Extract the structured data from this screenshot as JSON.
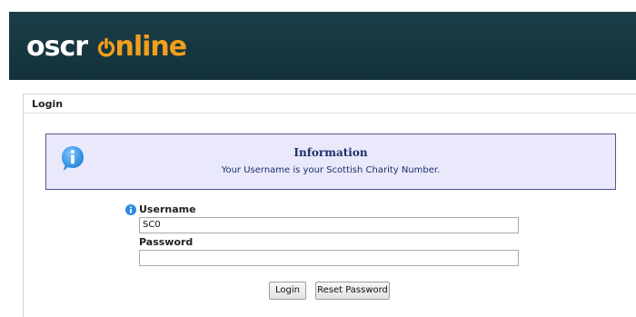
{
  "header": {
    "logo_part1": "oscr",
    "logo_part2": "nline",
    "logo_power_symbol": "power-icon"
  },
  "panel": {
    "title": "Login"
  },
  "info": {
    "icon": "info-icon",
    "title": "Information",
    "text": "Your Username is your Scottish Charity Number."
  },
  "form": {
    "username_label": "Username",
    "username_value": "SC0",
    "password_label": "Password",
    "password_value": "",
    "field_info_icon": "info-icon"
  },
  "buttons": {
    "login": "Login",
    "reset_password": "Reset Password"
  },
  "colors": {
    "header_bg": "#17363f",
    "logo_accent": "#f29f1d",
    "info_bg": "#e9e9fb",
    "info_border": "#55558a",
    "info_text": "#1e2e6a",
    "icon_blue": "#2a8be0"
  }
}
